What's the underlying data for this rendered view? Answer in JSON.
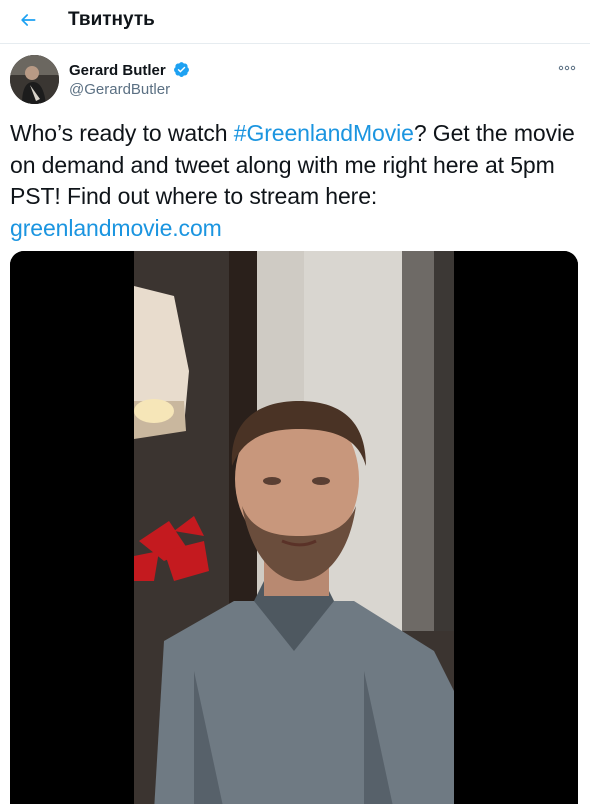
{
  "header": {
    "title": "Твитнуть",
    "back_icon": "back-arrow-icon",
    "accent_color": "#1da1f2"
  },
  "tweet": {
    "author_name": "Gerard Butler",
    "author_handle": "@GerardButler",
    "verified": true,
    "verified_icon": "verified-badge-icon",
    "more_icon": "more-options-icon",
    "text_before_hashtag": "Who’s ready to watch ",
    "hashtag": "#GreenlandMovie",
    "text_after_hashtag": "? Get the movie on demand and tweet along with me right here at 5pm PST! Find out where to stream here:",
    "link": "greenlandmovie.com",
    "link_color": "#1b95e0"
  },
  "media": {
    "type": "video",
    "description_icon": "video-thumbnail"
  }
}
